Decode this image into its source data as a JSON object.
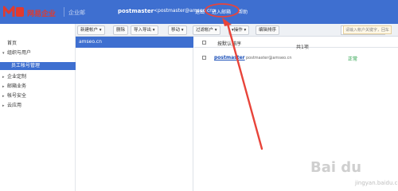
{
  "header": {
    "logo_text": "网易企业",
    "logo_sub": "企业邮",
    "user_name": "postmaster",
    "user_email": "<postmaster@amseo.cn>",
    "links": [
      "退出",
      "进入邮箱",
      "帮助"
    ]
  },
  "sidebar": {
    "items": [
      {
        "label": "首页",
        "expanded": false
      },
      {
        "label": "组织与用户",
        "expanded": true
      },
      {
        "label": "员工帐号管理",
        "active": true
      },
      {
        "label": "企业定制",
        "expanded": false
      },
      {
        "label": "邮箱业务",
        "expanded": false
      },
      {
        "label": "帐号安全",
        "expanded": false
      },
      {
        "label": "云应用",
        "expanded": false
      }
    ]
  },
  "toolbar": {
    "buttons": [
      "新建帐户 ▾",
      "删除",
      "导入导出 ▾",
      "移动 ▾",
      "过滤帐户 ▾",
      "▾操作 ▾",
      "编辑排序"
    ],
    "search_value": "",
    "search_hint": "请输入帐户关键字，回车"
  },
  "domain_column": {
    "selected_domain": "amseo.cn"
  },
  "list": {
    "header_col": "按默认排序",
    "count_label": "共1项",
    "rows": [
      {
        "name": "postmaster",
        "email": "postmaster@amseo.cn",
        "status": "正常"
      }
    ]
  },
  "watermark": {
    "brand": "Bai du",
    "sub": "jingyan.baidu.com"
  },
  "colors": {
    "header_bg": "#3e6fd0",
    "active_bg": "#3e6fd0",
    "annotation": "#e8443a",
    "status_ok": "#1a9b3e"
  }
}
